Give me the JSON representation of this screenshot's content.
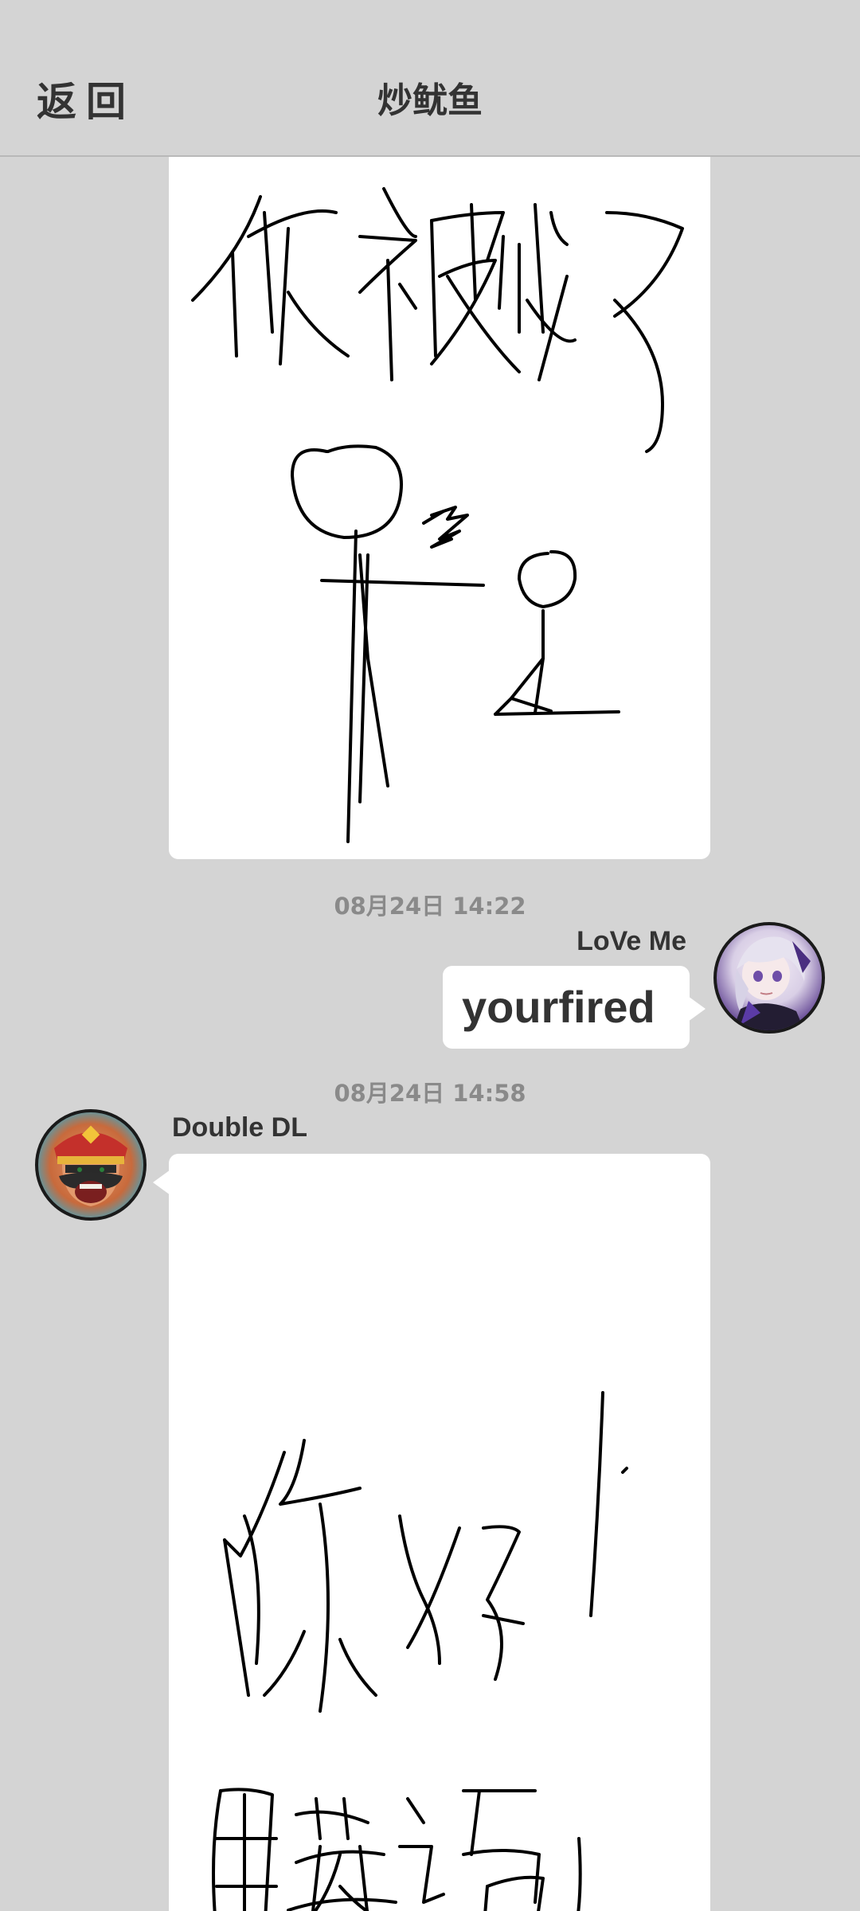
{
  "header": {
    "back_label": "返回",
    "title": "炒鱿鱼"
  },
  "messages": [
    {
      "type": "drawing",
      "sender": "",
      "handwritten_text": "你被炒了"
    },
    {
      "type": "timestamp",
      "text": "08月24日  14:22"
    },
    {
      "type": "text",
      "sender": "LoVe Me",
      "side": "right",
      "text": "yourfired",
      "avatar": "anime-girl-avatar"
    },
    {
      "type": "timestamp",
      "text": "08月24日  14:58"
    },
    {
      "type": "drawing",
      "sender": "Double DL",
      "side": "left",
      "avatar": "king-character-avatar",
      "handwritten_text": "你ⅹ了 用英语"
    }
  ],
  "colors": {
    "background": "#d4d4d4",
    "bubble": "#ffffff",
    "text": "#333333",
    "timestamp": "#8a8a8a"
  }
}
